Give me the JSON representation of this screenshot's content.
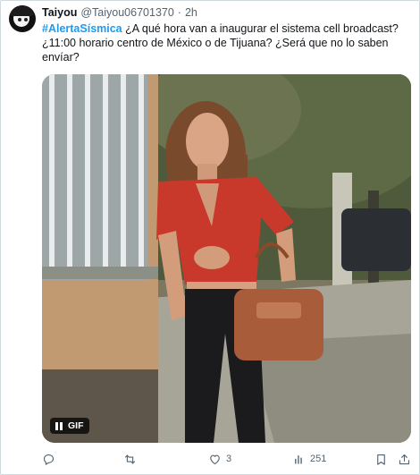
{
  "tweet": {
    "author": {
      "display_name": "Taiyou",
      "handle": "@Taiyou06701370",
      "separator": "·",
      "time": "2h"
    },
    "text": {
      "hashtag": "#AlertaSísmica",
      "body": " ¿A qué hora van a inaugurar el sistema cell broadcast? ¿11:00 horario centro de México o de Tijuana? ¿Será que no lo saben envíar?"
    },
    "media": {
      "badge_label": "GIF"
    },
    "actions": {
      "reply": {
        "icon": "reply-icon"
      },
      "retweet": {
        "icon": "retweet-icon"
      },
      "like": {
        "icon": "heart-icon",
        "count": "3"
      },
      "views": {
        "icon": "bar-chart-icon",
        "count": "251"
      },
      "bookmark": {
        "icon": "bookmark-icon"
      },
      "share": {
        "icon": "share-icon"
      }
    }
  },
  "colors": {
    "accent": "#1d9bf0",
    "text": "#0f1419",
    "secondary_text": "#536471",
    "border": "#cfd9de"
  }
}
